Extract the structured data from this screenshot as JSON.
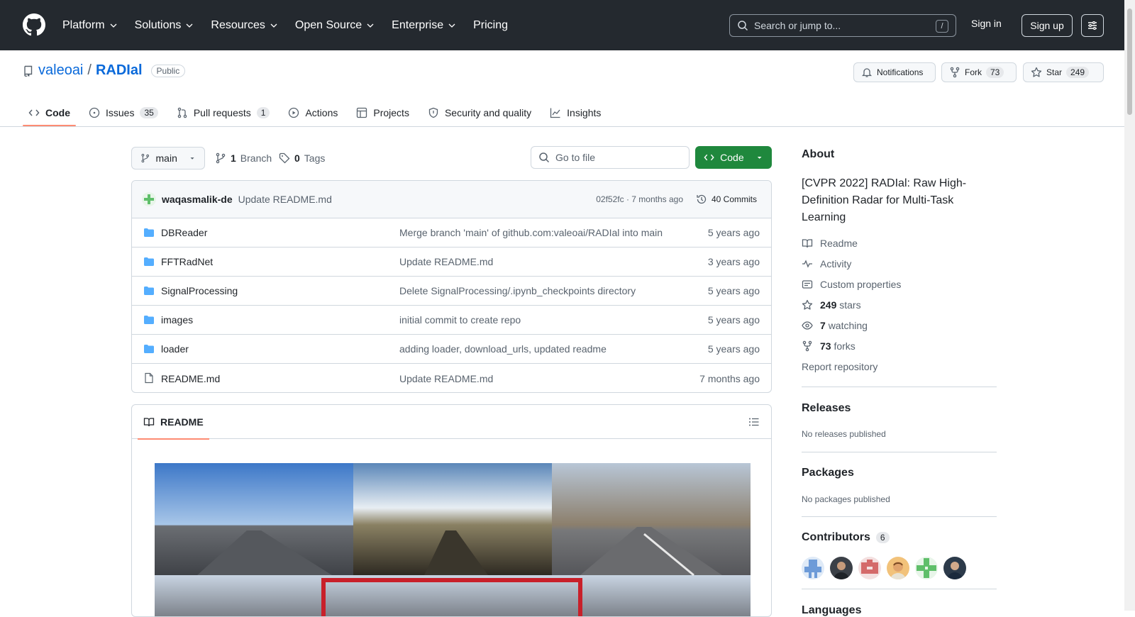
{
  "nav": {
    "items": [
      {
        "label": "Platform"
      },
      {
        "label": "Solutions"
      },
      {
        "label": "Resources"
      },
      {
        "label": "Open Source"
      },
      {
        "label": "Enterprise"
      },
      {
        "label": "Pricing"
      }
    ],
    "search_placeholder": "Search or jump to...",
    "search_shortcut": "/",
    "sign_in": "Sign in",
    "sign_up": "Sign up"
  },
  "repo": {
    "owner": "valeoai",
    "separator": "/",
    "name": "RADIal",
    "visibility": "Public",
    "notifications_label": "Notifications",
    "fork_label": "Fork",
    "fork_count": "73",
    "star_label": "Star",
    "star_count": "249"
  },
  "tabs": [
    {
      "label": "Code",
      "count": ""
    },
    {
      "label": "Issues",
      "count": "35"
    },
    {
      "label": "Pull requests",
      "count": "1"
    },
    {
      "label": "Actions",
      "count": ""
    },
    {
      "label": "Projects",
      "count": ""
    },
    {
      "label": "Security and quality",
      "count": ""
    },
    {
      "label": "Insights",
      "count": ""
    }
  ],
  "toolbar": {
    "branch": "main",
    "branch_count": "1",
    "branch_label": "Branch",
    "tag_count": "0",
    "tag_label": "Tags",
    "goto_placeholder": "Go to file",
    "code_label": "Code"
  },
  "commit": {
    "author": "waqasmalik-de",
    "message": "Update README.md",
    "hash_time": "02f52fc · 7 months ago",
    "commits_label": "40 Commits"
  },
  "files": [
    {
      "name": "DBReader",
      "type": "dir",
      "message": "Merge branch 'main' of github.com:valeoai/RADIal into main",
      "age": "5 years ago"
    },
    {
      "name": "FFTRadNet",
      "type": "dir",
      "message": "Update README.md",
      "age": "3 years ago"
    },
    {
      "name": "SignalProcessing",
      "type": "dir",
      "message": "Delete SignalProcessing/.ipynb_checkpoints directory",
      "age": "5 years ago"
    },
    {
      "name": "images",
      "type": "dir",
      "message": "initial commit to create repo",
      "age": "5 years ago"
    },
    {
      "name": "loader",
      "type": "dir",
      "message": "adding loader, download_urls, updated readme",
      "age": "5 years ago"
    },
    {
      "name": "README.md",
      "type": "file",
      "message": "Update README.md",
      "age": "7 months ago"
    }
  ],
  "readme": {
    "tab_label": "README"
  },
  "about": {
    "title": "About",
    "description": "[CVPR 2022] RADIal: Raw High-Definition Radar for Multi-Task Learning",
    "readme": "Readme",
    "activity": "Activity",
    "custom_properties": "Custom properties",
    "stars_count": "249",
    "stars_label": "stars",
    "watching_count": "7",
    "watching_label": "watching",
    "forks_count": "73",
    "forks_label": "forks",
    "report": "Report repository"
  },
  "releases": {
    "title": "Releases",
    "empty": "No releases published"
  },
  "packages": {
    "title": "Packages",
    "empty": "No packages published"
  },
  "contributors": {
    "title": "Contributors",
    "count": "6"
  },
  "languages": {
    "title": "Languages"
  }
}
